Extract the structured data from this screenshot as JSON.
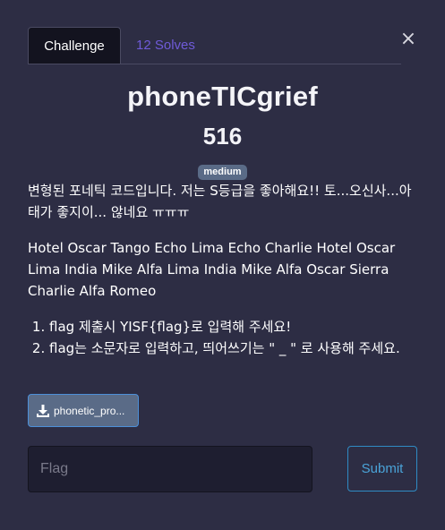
{
  "tabs": {
    "challenge_label": "Challenge",
    "solves_label": "12 Solves"
  },
  "close": {
    "symbol": "×"
  },
  "challenge": {
    "name": "phoneTICgrief",
    "points": "516",
    "difficulty": "medium",
    "description_line1": "변형된 포네틱 코드입니다. 저는 S등급을 좋아해요!! 토...오신사...아태가 좋지이... 않네요 ㅠㅠㅠ",
    "description_line2": "Hotel Oscar Tango Echo Lima Echo Charlie Hotel Oscar Lima India Mike Alfa Lima India Mike Alfa Oscar Sierra Charlie Alfa Romeo",
    "rules": [
      "flag 제출시 YISF{flag}로 입력해 주세요!",
      "flag는 소문자로 입력하고, 띄어쓰기는 \" _ \" 로 사용해 주세요."
    ]
  },
  "file": {
    "label": "phonetic_pro...",
    "icon": "download-icon"
  },
  "form": {
    "flag_placeholder": "Flag",
    "flag_value": "",
    "submit_label": "Submit"
  },
  "colors": {
    "background": "#2d2d44",
    "tab_active_bg": "#13131f",
    "tab_inactive_text": "#6f5bd9",
    "badge_bg": "#5a6b87",
    "submit_border": "#2f8bc4"
  }
}
